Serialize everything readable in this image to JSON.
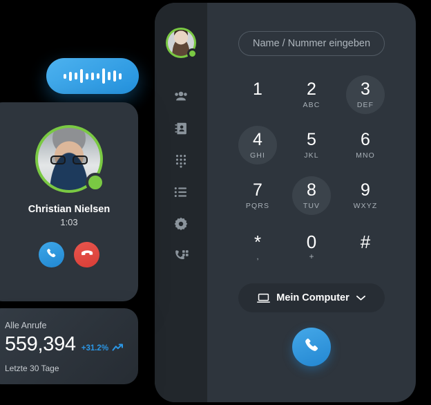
{
  "colors": {
    "background": "#000000",
    "panel": "#2e353d",
    "sidebar": "#22272c",
    "accent_blue": "#2187d1",
    "status_green": "#7ac943",
    "decline_red": "#d93d36",
    "key_highlight": "#3b434b"
  },
  "sidebar": {
    "avatar": {
      "name": "user-avatar",
      "status": "online"
    },
    "items": [
      {
        "icon": "contacts-icon",
        "label": "Kontakte"
      },
      {
        "icon": "addressbook-icon",
        "label": "Adressbuch"
      },
      {
        "icon": "dialpad-icon",
        "label": "Wähltastatur"
      },
      {
        "icon": "calllist-icon",
        "label": "Anrufliste"
      },
      {
        "icon": "gear-icon",
        "label": "Einstellungen"
      },
      {
        "icon": "call-transfer-icon",
        "label": "Anruf weiterleiten"
      }
    ]
  },
  "dialer": {
    "input": {
      "placeholder": "Name / Nummer eingeben",
      "value": ""
    },
    "keys": [
      {
        "digit": "1",
        "letters": "",
        "highlighted": false
      },
      {
        "digit": "2",
        "letters": "ABC",
        "highlighted": false
      },
      {
        "digit": "3",
        "letters": "DEF",
        "highlighted": true
      },
      {
        "digit": "4",
        "letters": "GHI",
        "highlighted": true
      },
      {
        "digit": "5",
        "letters": "JKL",
        "highlighted": false
      },
      {
        "digit": "6",
        "letters": "MNO",
        "highlighted": false
      },
      {
        "digit": "7",
        "letters": "PQRS",
        "highlighted": false
      },
      {
        "digit": "8",
        "letters": "TUV",
        "highlighted": true
      },
      {
        "digit": "9",
        "letters": "WXYZ",
        "highlighted": false
      },
      {
        "digit": "*",
        "letters": ",",
        "highlighted": false,
        "symbol": true
      },
      {
        "digit": "0",
        "letters": "+",
        "highlighted": false,
        "symbol": true
      },
      {
        "digit": "#",
        "letters": "",
        "highlighted": false,
        "symbol": true
      }
    ],
    "device_select": {
      "label": "Mein Computer",
      "icon": "laptop-icon",
      "chevron": "chevron-down-icon"
    },
    "call_button": {
      "icon": "phone-icon",
      "label": "Anrufen"
    }
  },
  "waveform_pill": {
    "icon": "audio-waveform-icon",
    "bars": [
      7,
      13,
      10,
      20,
      9,
      11,
      8,
      22,
      12,
      16,
      9
    ]
  },
  "caller_card": {
    "avatar": {
      "name": "caller-avatar",
      "status": "online"
    },
    "name": "Christian Nielsen",
    "duration": "1:03",
    "answer_button": {
      "icon": "phone-icon",
      "label": "Annehmen"
    },
    "decline_button": {
      "icon": "phone-hangup-icon",
      "label": "Auflegen"
    }
  },
  "stats_card": {
    "title": "Alle Anrufe",
    "value": "559,394",
    "delta": "+31.2%",
    "trend_icon": "trend-up-icon",
    "subtitle": "Letzte 30 Tage"
  }
}
